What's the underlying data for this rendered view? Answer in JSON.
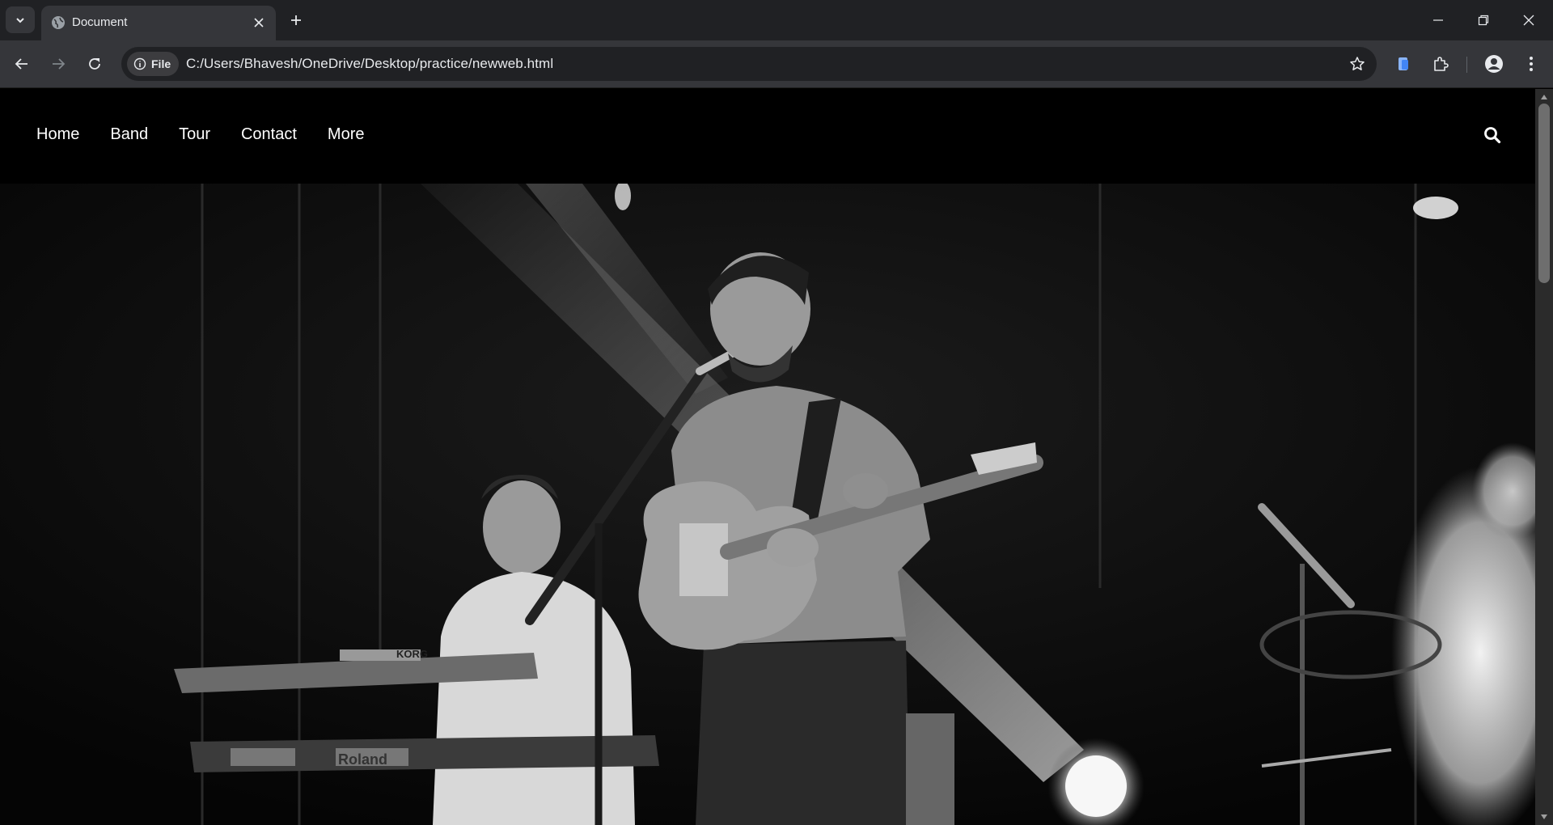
{
  "browser": {
    "tab_title": "Document",
    "site_chip_label": "File",
    "url": "C:/Users/Bhavesh/OneDrive/Desktop/practice/newweb.html"
  },
  "site_nav": {
    "links": [
      "Home",
      "Band",
      "Tour",
      "Contact",
      "More"
    ]
  },
  "hero": {
    "logo_left": "KORG",
    "logo_right": "Roland"
  }
}
